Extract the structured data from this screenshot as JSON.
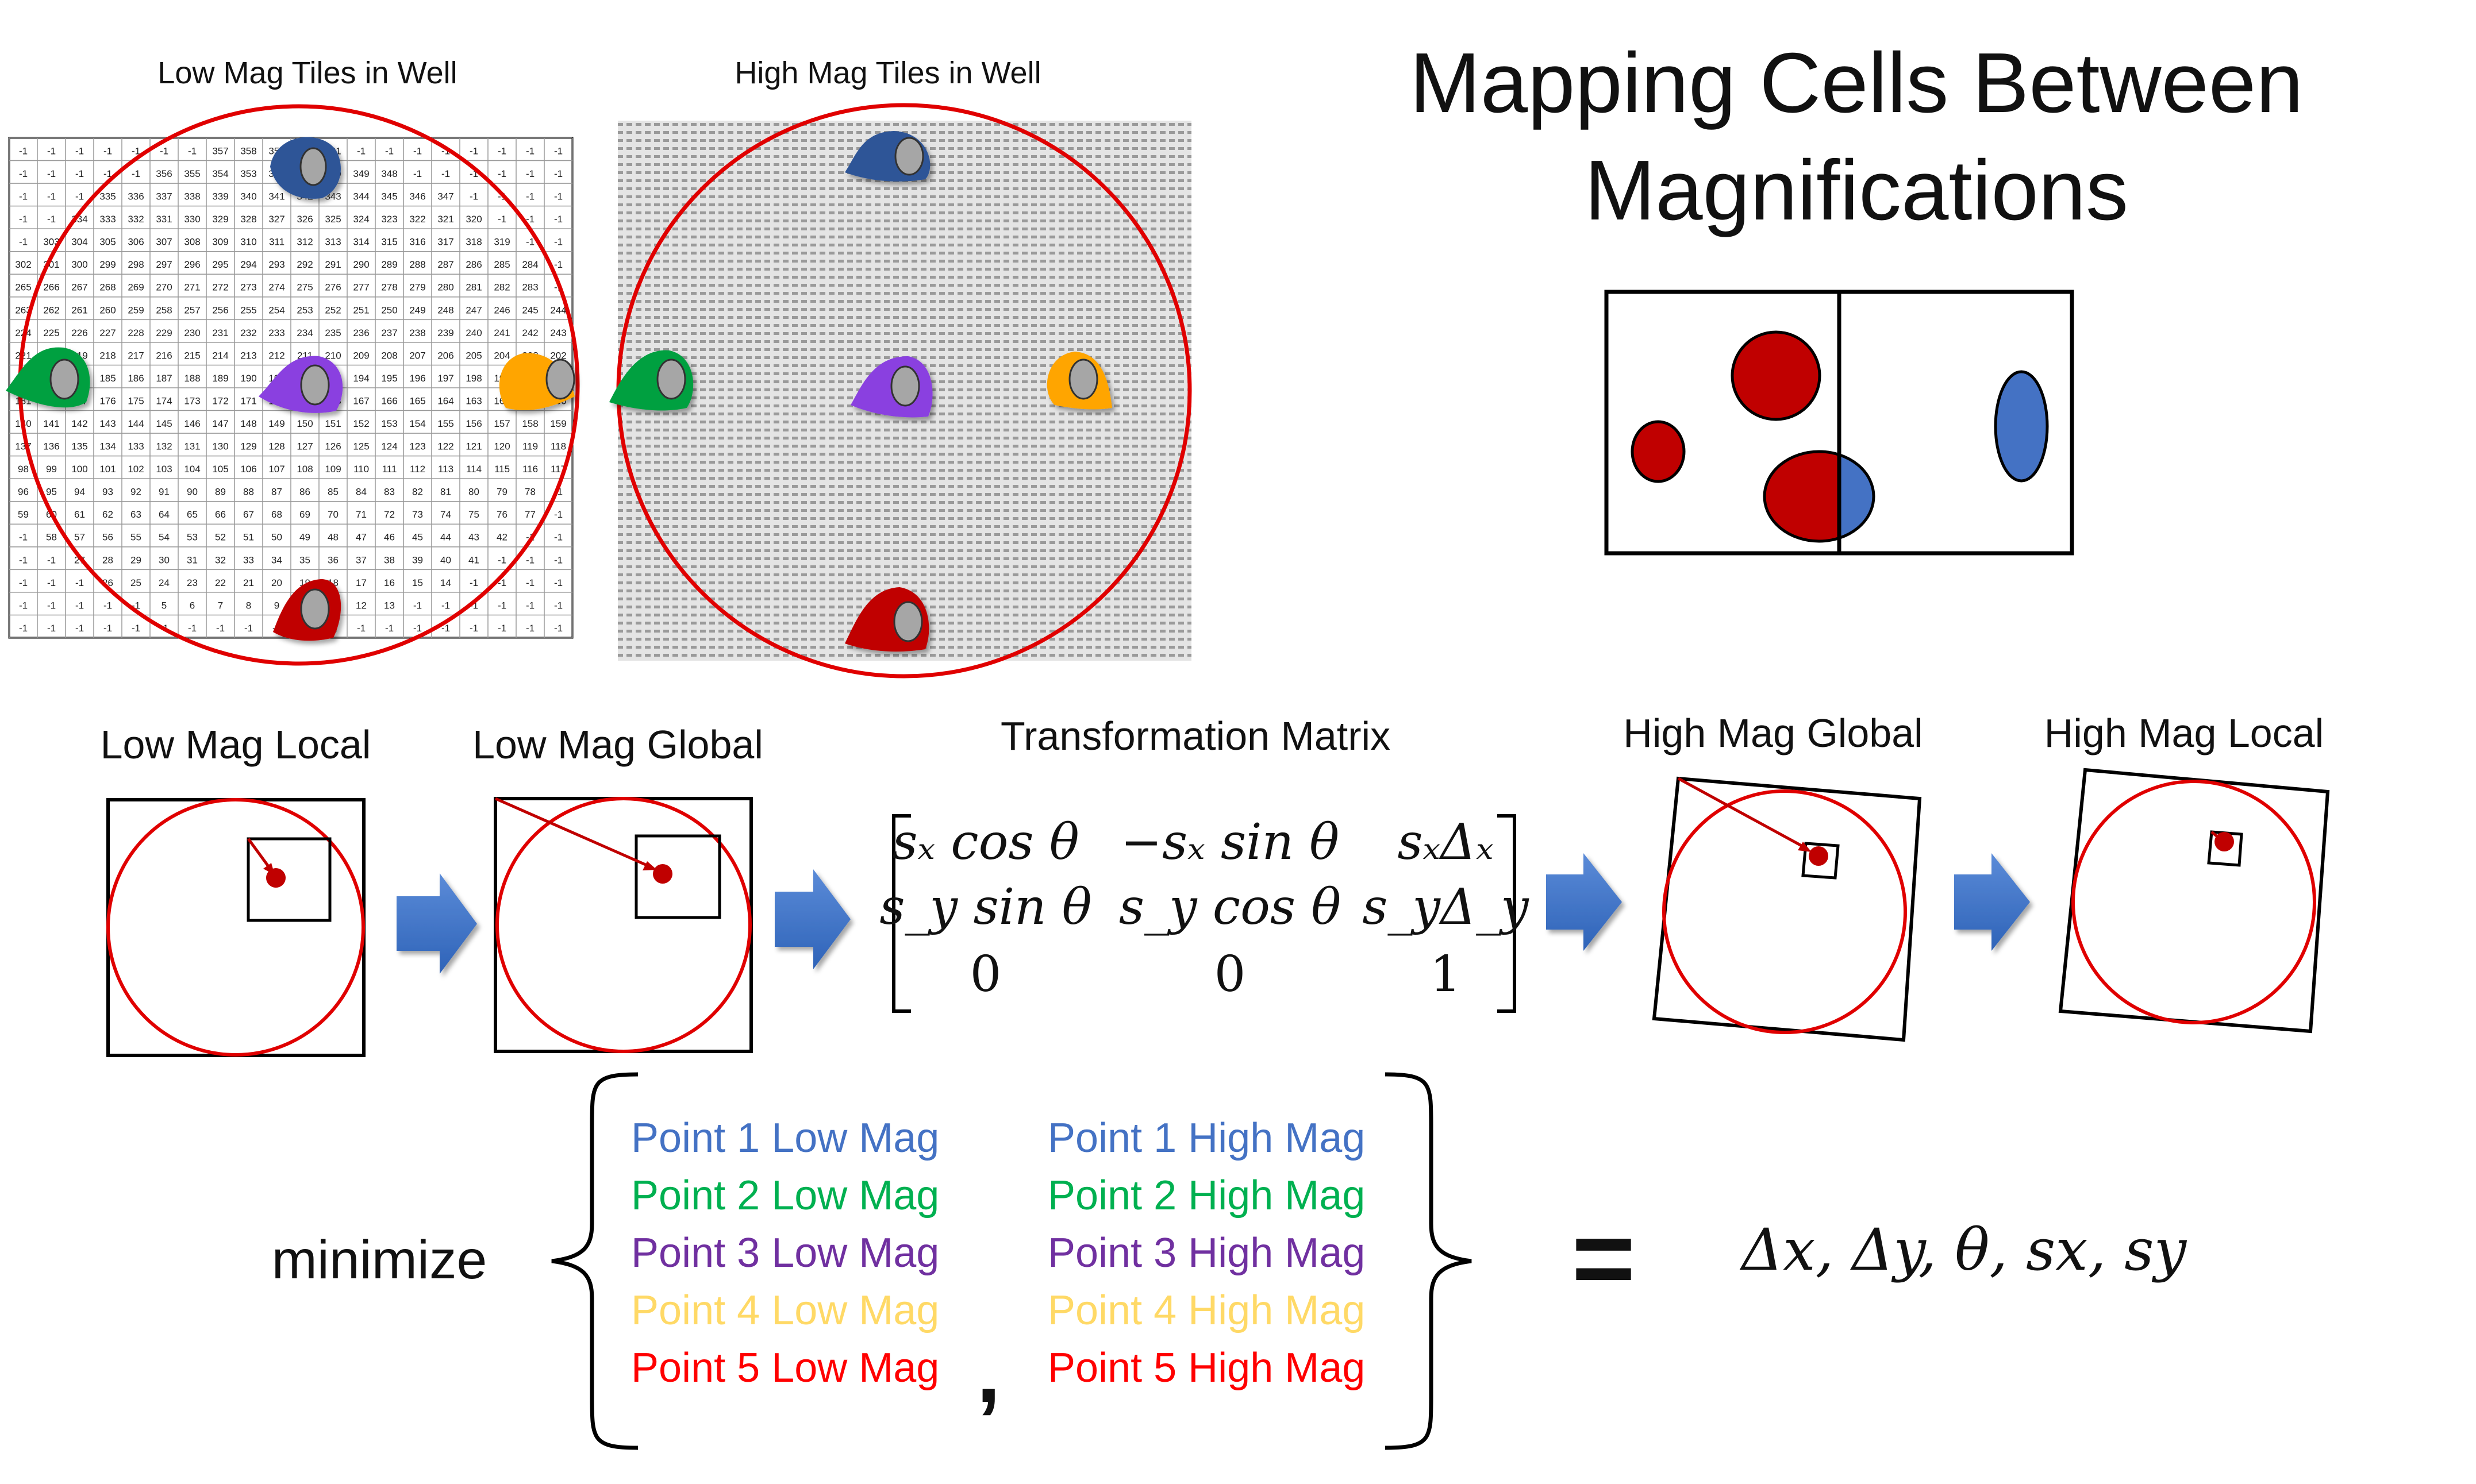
{
  "title_lines": [
    "Mapping Cells Between",
    "Magnifications"
  ],
  "panels": {
    "low_tiles_title": "Low Mag Tiles in Well",
    "high_tiles_title": "High Mag Tiles in Well"
  },
  "tile_grid": {
    "rows": [
      [
        "-1",
        "-1",
        "-1",
        "-1",
        "-1",
        "-1",
        "-1",
        "357",
        "358",
        "359",
        "360",
        "361",
        "-1",
        "-1",
        "-1",
        "-1",
        "-1",
        "-1",
        "-1",
        "-1"
      ],
      [
        "-1",
        "-1",
        "-1",
        "-1",
        "-1",
        "356",
        "355",
        "354",
        "353",
        "352",
        "351",
        "350",
        "349",
        "348",
        "-1",
        "-1",
        "-1",
        "-1",
        "-1",
        "-1"
      ],
      [
        "-1",
        "-1",
        "-1",
        "335",
        "336",
        "337",
        "338",
        "339",
        "340",
        "341",
        "342",
        "343",
        "344",
        "345",
        "346",
        "347",
        "-1",
        "-1",
        "-1",
        "-1"
      ],
      [
        "-1",
        "-1",
        "334",
        "333",
        "332",
        "331",
        "330",
        "329",
        "328",
        "327",
        "326",
        "325",
        "324",
        "323",
        "322",
        "321",
        "320",
        "-1",
        "-1",
        "-1"
      ],
      [
        "-1",
        "303",
        "304",
        "305",
        "306",
        "307",
        "308",
        "309",
        "310",
        "311",
        "312",
        "313",
        "314",
        "315",
        "316",
        "317",
        "318",
        "319",
        "-1",
        "-1"
      ],
      [
        "302",
        "301",
        "300",
        "299",
        "298",
        "297",
        "296",
        "295",
        "294",
        "293",
        "292",
        "291",
        "290",
        "289",
        "288",
        "287",
        "286",
        "285",
        "284",
        "-1"
      ],
      [
        "265",
        "266",
        "267",
        "268",
        "269",
        "270",
        "271",
        "272",
        "273",
        "274",
        "275",
        "276",
        "277",
        "278",
        "279",
        "280",
        "281",
        "282",
        "283",
        "-1"
      ],
      [
        "263",
        "262",
        "261",
        "260",
        "259",
        "258",
        "257",
        "256",
        "255",
        "254",
        "253",
        "252",
        "251",
        "250",
        "249",
        "248",
        "247",
        "246",
        "245",
        "244"
      ],
      [
        "224",
        "225",
        "226",
        "227",
        "228",
        "229",
        "230",
        "231",
        "232",
        "233",
        "234",
        "235",
        "236",
        "237",
        "238",
        "239",
        "240",
        "241",
        "242",
        "243"
      ],
      [
        "221",
        "220",
        "219",
        "218",
        "217",
        "216",
        "215",
        "214",
        "213",
        "212",
        "211",
        "210",
        "209",
        "208",
        "207",
        "206",
        "205",
        "204",
        "203",
        "202"
      ],
      [
        "182",
        "183",
        "184",
        "185",
        "186",
        "187",
        "188",
        "189",
        "190",
        "191",
        "192",
        "193",
        "194",
        "195",
        "196",
        "197",
        "198",
        "199",
        "200",
        "201"
      ],
      [
        "181",
        "180",
        "177",
        "176",
        "175",
        "174",
        "173",
        "172",
        "171",
        "170",
        "169",
        "168",
        "167",
        "166",
        "165",
        "164",
        "163",
        "162",
        "161",
        "160"
      ],
      [
        "140",
        "141",
        "142",
        "143",
        "144",
        "145",
        "146",
        "147",
        "148",
        "149",
        "150",
        "151",
        "152",
        "153",
        "154",
        "155",
        "156",
        "157",
        "158",
        "159"
      ],
      [
        "137",
        "136",
        "135",
        "134",
        "133",
        "132",
        "131",
        "130",
        "129",
        "128",
        "127",
        "126",
        "125",
        "124",
        "123",
        "122",
        "121",
        "120",
        "119",
        "118"
      ],
      [
        "98",
        "99",
        "100",
        "101",
        "102",
        "103",
        "104",
        "105",
        "106",
        "107",
        "108",
        "109",
        "110",
        "111",
        "112",
        "113",
        "114",
        "115",
        "116",
        "117"
      ],
      [
        "96",
        "95",
        "94",
        "93",
        "92",
        "91",
        "90",
        "89",
        "88",
        "87",
        "86",
        "85",
        "84",
        "83",
        "82",
        "81",
        "80",
        "79",
        "78",
        "-1"
      ],
      [
        "59",
        "60",
        "61",
        "62",
        "63",
        "64",
        "65",
        "66",
        "67",
        "68",
        "69",
        "70",
        "71",
        "72",
        "73",
        "74",
        "75",
        "76",
        "77",
        "-1"
      ],
      [
        "-1",
        "58",
        "57",
        "56",
        "55",
        "54",
        "53",
        "52",
        "51",
        "50",
        "49",
        "48",
        "47",
        "46",
        "45",
        "44",
        "43",
        "42",
        "-1",
        "-1"
      ],
      [
        "-1",
        "-1",
        "27",
        "28",
        "29",
        "30",
        "31",
        "32",
        "33",
        "34",
        "35",
        "36",
        "37",
        "38",
        "39",
        "40",
        "41",
        "-1",
        "-1",
        "-1"
      ],
      [
        "-1",
        "-1",
        "-1",
        "26",
        "25",
        "24",
        "23",
        "22",
        "21",
        "20",
        "19",
        "18",
        "17",
        "16",
        "15",
        "14",
        "-1",
        "-1",
        "-1",
        "-1"
      ],
      [
        "-1",
        "-1",
        "-1",
        "-1",
        "-1",
        "5",
        "6",
        "7",
        "8",
        "9",
        "10",
        "11",
        "12",
        "13",
        "-1",
        "-1",
        "-1",
        "-1",
        "-1",
        "-1"
      ],
      [
        "-1",
        "-1",
        "-1",
        "-1",
        "-1",
        "-1",
        "-1",
        "-1",
        "-1",
        "-1",
        "-1",
        "-1",
        "-1",
        "-1",
        "-1",
        "-1",
        "-1",
        "-1",
        "-1",
        "-1"
      ]
    ]
  },
  "steps": {
    "low_local": "Low Mag Local",
    "low_global": "Low Mag Global",
    "matrix_title": "Transformation Matrix",
    "high_global": "High Mag Global",
    "high_local": "High Mag Local"
  },
  "matrix": [
    [
      "sₓ cos θ",
      "−sₓ sin θ",
      "sₓΔₓ"
    ],
    [
      "s_y sin θ",
      "s_y cos θ",
      "s_yΔ_y"
    ],
    [
      "0",
      "0",
      "1"
    ]
  ],
  "objective": {
    "minimize_label": "minimize",
    "pairs": [
      {
        "low": "Point 1 Low Mag",
        "high": "Point 1 High Mag",
        "color": "#4472C4"
      },
      {
        "low": "Point 2 Low Mag",
        "high": "Point 2 High Mag",
        "color": "#00B050"
      },
      {
        "low": "Point 3 Low Mag",
        "high": "Point 3 High Mag",
        "color": "#7030A0"
      },
      {
        "low": "Point 4 Low Mag",
        "high": "Point 4 High Mag",
        "color": "#FFD966"
      },
      {
        "low": "Point 5 Low Mag",
        "high": "Point 5 High Mag",
        "color": "#FF0000"
      }
    ],
    "comma": ",",
    "equals": "=",
    "result": "Δx, Δy, θ, sx, sy"
  },
  "colors": {
    "red": "#E00000",
    "blue_arrow": "#4472C4",
    "cell_blue": "#2F5597",
    "cell_green": "#00A040",
    "cell_purple": "#8A3FE0",
    "cell_orange": "#FFA500",
    "cell_red": "#C00000"
  }
}
